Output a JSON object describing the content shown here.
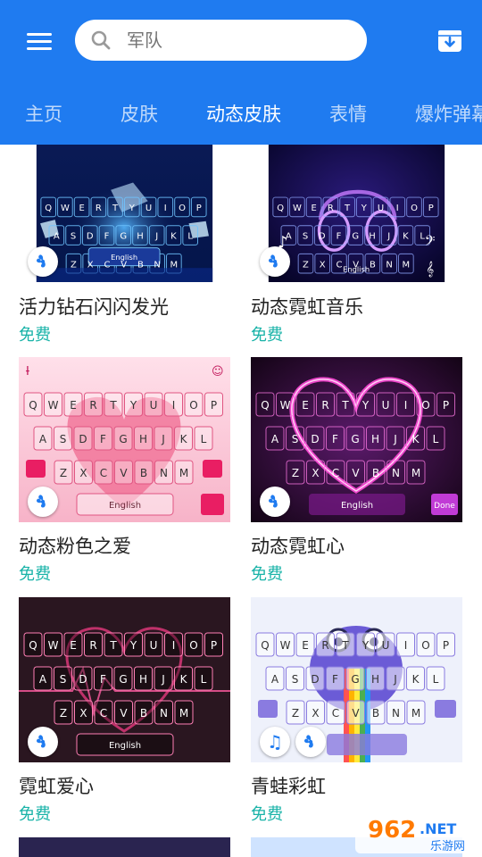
{
  "search": {
    "placeholder": "军队"
  },
  "tabs": [
    {
      "label": "主页"
    },
    {
      "label": "皮肤"
    },
    {
      "label": "动态皮肤"
    },
    {
      "label": "表情"
    },
    {
      "label": "爆炸弹幕"
    }
  ],
  "active_tab": "动态皮肤",
  "skins": [
    {
      "name": "活力钻石闪闪发光",
      "price": "免费"
    },
    {
      "name": "动态霓虹音乐",
      "price": "免费"
    },
    {
      "name": "动态粉色之爱",
      "price": "免费"
    },
    {
      "name": "动态霓虹心",
      "price": "免费"
    },
    {
      "name": "霓虹爱心",
      "price": "免费"
    },
    {
      "name": "青蛙彩虹",
      "price": "免费"
    }
  ],
  "keyboard": {
    "row1": [
      "Q",
      "W",
      "E",
      "R",
      "T",
      "Y",
      "U",
      "I",
      "O",
      "P"
    ],
    "row2": [
      "A",
      "S",
      "D",
      "F",
      "G",
      "H",
      "J",
      "K",
      "L"
    ],
    "row3": [
      "Z",
      "X",
      "C",
      "V",
      "B",
      "N",
      "M"
    ],
    "space_label": "English",
    "done_label": "Done"
  },
  "watermark": {
    "number": "962",
    "suffix": ".NET",
    "cn": "乐游网"
  },
  "colors": {
    "brand": "#1f7bf0",
    "price": "#19b3a8"
  }
}
